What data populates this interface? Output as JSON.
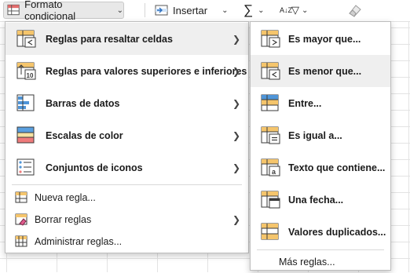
{
  "ribbon": {
    "conditional_format_label": "Formato condicional",
    "insert_label": "Insertar",
    "sum_glyph": "∑",
    "sort_glyph": "A↓Z"
  },
  "menu": {
    "items": [
      {
        "label": "Reglas para resaltar celdas",
        "icon": "highlight-rules-icon"
      },
      {
        "label": "Reglas para valores superiores e inferiores",
        "icon": "top-bottom-rules-icon"
      },
      {
        "label": "Barras de datos",
        "icon": "data-bars-icon"
      },
      {
        "label": "Escalas de color",
        "icon": "color-scales-icon"
      },
      {
        "label": "Conjuntos de iconos",
        "icon": "icon-sets-icon"
      }
    ],
    "actions": [
      {
        "label": "Nueva regla...",
        "icon": "new-rule-icon"
      },
      {
        "label": "Borrar reglas",
        "icon": "clear-rules-icon"
      },
      {
        "label": "Administrar reglas...",
        "icon": "manage-rules-icon"
      }
    ]
  },
  "submenu": {
    "items": [
      {
        "label": "Es mayor que...",
        "icon": "greater-than-icon"
      },
      {
        "label": "Es menor que...",
        "icon": "less-than-icon"
      },
      {
        "label": "Entre...",
        "icon": "between-icon"
      },
      {
        "label": "Es igual a...",
        "icon": "equal-to-icon"
      },
      {
        "label": "Texto que contiene...",
        "icon": "text-contains-icon"
      },
      {
        "label": "Una fecha...",
        "icon": "date-occurring-icon"
      },
      {
        "label": "Valores duplicados...",
        "icon": "duplicate-values-icon"
      }
    ],
    "more_label": "Más reglas..."
  },
  "colors": {
    "accent_orange": "#f5c56c",
    "accent_blue": "#4f95d8",
    "icon_dark": "#3a3a3a",
    "highlight": "#efefef"
  }
}
